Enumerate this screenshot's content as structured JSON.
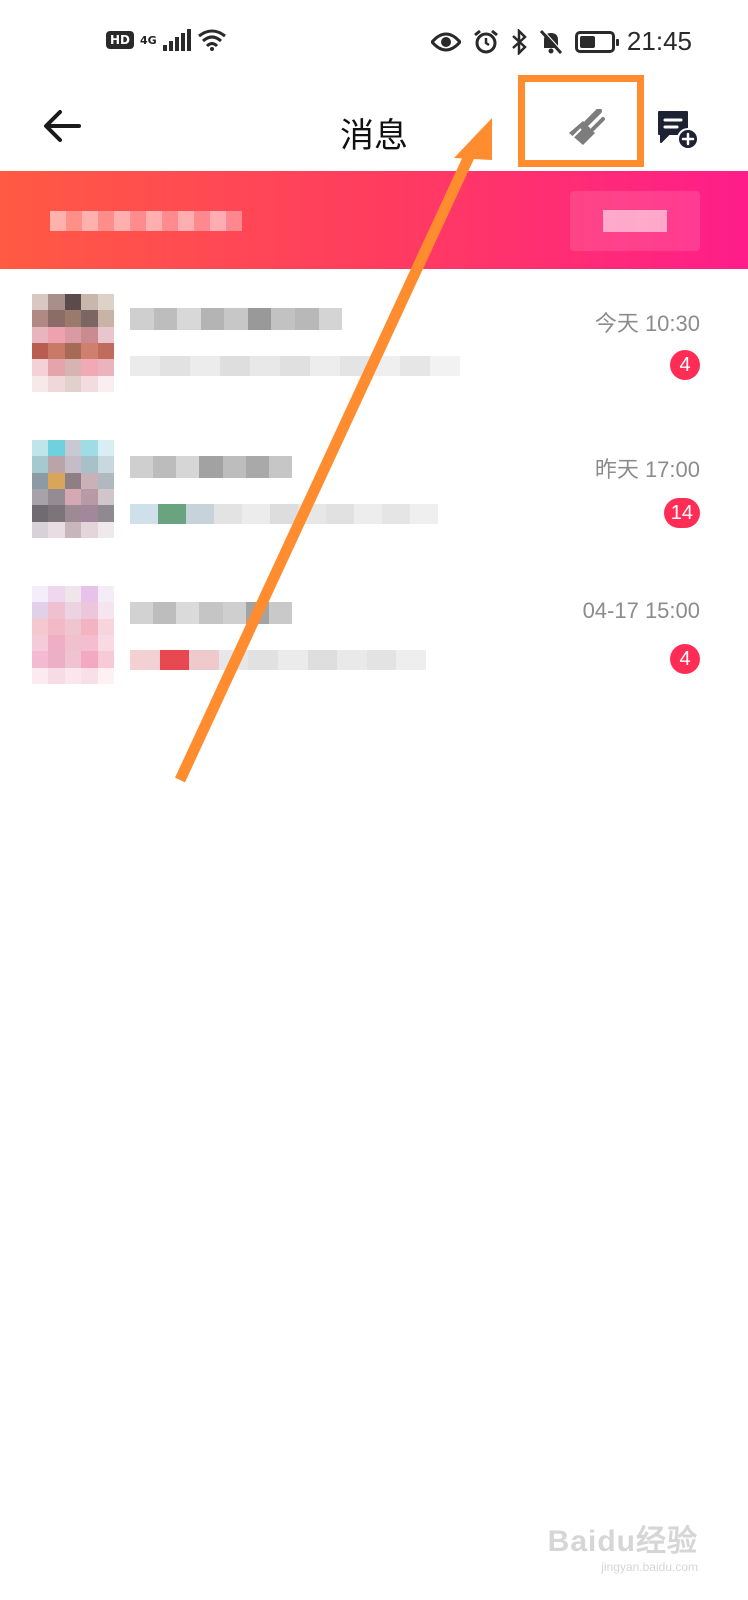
{
  "status_bar": {
    "hd_label": "HD",
    "network_label": "4G",
    "time": "21:45",
    "battery_level": 0.5
  },
  "nav": {
    "title": "消息"
  },
  "conversations": [
    {
      "time": "今天 10:30",
      "unread": "4"
    },
    {
      "time": "昨天 17:00",
      "unread": "14"
    },
    {
      "time": "04-17 15:00",
      "unread": "4"
    }
  ],
  "watermark": {
    "logo_text": "Baidu经验",
    "url_text": "jingyan.baidu.com"
  },
  "colors": {
    "accent_highlight": "#ff8c2f",
    "banner_start": "#ff5a43",
    "banner_end": "#ff1d8a",
    "badge": "#ff2d55"
  },
  "icons": {
    "back": "arrow-left-icon",
    "clean": "broom-icon",
    "new_message": "chat-add-icon"
  }
}
